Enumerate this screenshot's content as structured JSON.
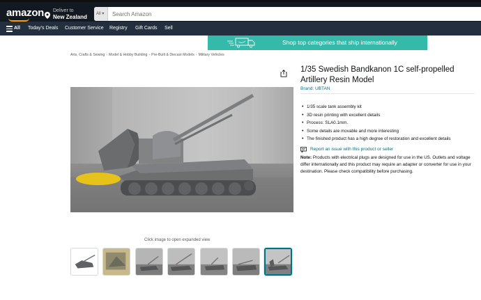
{
  "header": {
    "logo": "amazon",
    "deliver_line1": "Deliver to",
    "deliver_line2": "New Zealand",
    "search_category": "All",
    "search_placeholder": "Search Amazon"
  },
  "nav": {
    "all_label": "All",
    "items": [
      "Today's Deals",
      "Customer Service",
      "Registry",
      "Gift Cards",
      "Sell"
    ]
  },
  "promo": {
    "text": "Shop top categories that ship internationally"
  },
  "breadcrumbs": [
    "Arts, Crafts & Sewing",
    "Model & Hobby Building",
    "Pre-Built & Diecast Models",
    "Military Vehicles"
  ],
  "breadcrumb_separator": "›",
  "gallery": {
    "click_hint": "Click image to open expanded view",
    "thumbnail_count": 7,
    "selected_thumbnail": 7
  },
  "product": {
    "title": "1/35 Swedish Bandkanon 1C self-propelled Artillery Resin Model",
    "brand": "Brand: UBTAN",
    "bullets": [
      "1/35 scale tank assembly kit",
      "3D resin printing with excellent details",
      "Process: SLA0.1mm.",
      "Some details are movable and more interesting",
      "The finished product has a high degree of restoration and excellent details"
    ],
    "report_link": "Report an issue with this product or seller",
    "note_label": "Note:",
    "note_text": " Products with electrical plugs are designed for use in the US. Outlets and voltage differ internationally and this product may require an adapter or converter for use in your destination. Please check compatibility before purchasing."
  },
  "colors": {
    "header_bg": "#131921",
    "nav_bg": "#232f3e",
    "promo_bg": "#35b9a8",
    "link": "#007185",
    "logo_accent": "#ff9900"
  }
}
